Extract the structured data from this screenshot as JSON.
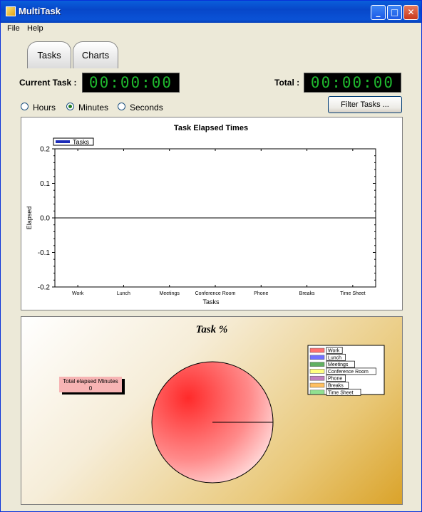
{
  "window": {
    "title": "MultiTask",
    "min_label": "_",
    "max_label": "□",
    "close_label": "✕"
  },
  "menu": [
    "File",
    "Help"
  ],
  "tabs": [
    "Tasks",
    "Charts"
  ],
  "timers": {
    "current_label": "Current Task :",
    "current_value": "00:00:00",
    "total_label": "Total :",
    "total_value": "00:00:00"
  },
  "units": {
    "options": [
      "Hours",
      "Minutes",
      "Seconds"
    ],
    "selected": "Minutes"
  },
  "filter_button": "Filter Tasks ...",
  "bar_chart": {
    "chart_data": {
      "type": "bar",
      "title": "Task Elapsed Times",
      "legend": [
        "Tasks"
      ],
      "legend_position": "top-left",
      "xlabel": "Tasks",
      "ylabel": "Elapsed",
      "categories": [
        "Work",
        "Lunch",
        "Meetings",
        "Conference Room",
        "Phone",
        "Breaks",
        "Time Sheet"
      ],
      "series": [
        {
          "name": "Tasks",
          "values": [
            0,
            0,
            0,
            0,
            0,
            0,
            0
          ]
        }
      ],
      "ylim": [
        -0.2,
        0.2
      ],
      "yticks": [
        "0.2",
        "0.1",
        "0.0",
        "-0.1",
        "-0.2"
      ],
      "colors": {
        "legend_swatch": "#1c2cb8"
      }
    }
  },
  "pie_chart": {
    "chart_data": {
      "type": "pie",
      "title": "Task %",
      "categories": [
        "Work",
        "Lunch",
        "Meetings",
        "Conference Room",
        "Phone",
        "Breaks",
        "Time Sheet"
      ],
      "values": [
        100,
        0,
        0,
        0,
        0,
        0,
        0
      ],
      "legend_position": "top-right",
      "colors": [
        "#ff7070",
        "#7070ff",
        "#60b060",
        "#ffff80",
        "#c080c0",
        "#ffc060",
        "#90e090"
      ]
    },
    "total_label": "Total elapsed Minutes",
    "total_value": "0"
  }
}
